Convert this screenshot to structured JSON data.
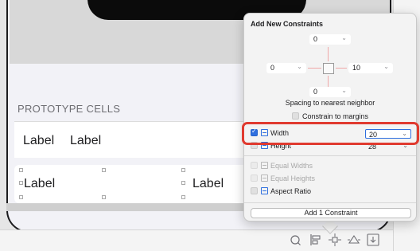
{
  "canvas": {
    "section_header": "PROTOTYPE CELLS",
    "cell1": {
      "label_a": "Label",
      "label_b": "Label"
    },
    "cell2": {
      "label_a": "Label",
      "label_b": "Label"
    }
  },
  "bottom_toolbar": {
    "icons": [
      "update-frames-icon",
      "align-icon",
      "add-constraints-icon",
      "resolve-issues-icon",
      "embed-in-icon"
    ]
  },
  "popover": {
    "title": "Add New Constraints",
    "spacing": {
      "top": "0",
      "leading": "0",
      "trailing": "10",
      "bottom": "0"
    },
    "spacing_caption": "Spacing to nearest neighbor",
    "constrain_to_margins": {
      "label": "Constrain to margins",
      "checked": false
    },
    "width": {
      "label": "Width",
      "value": "20",
      "checked": true
    },
    "height": {
      "label": "Height",
      "value": "28",
      "checked": false
    },
    "equal_widths": {
      "label": "Equal Widths",
      "enabled": false
    },
    "equal_heights": {
      "label": "Equal Heights",
      "enabled": false
    },
    "aspect_ratio": {
      "label": "Aspect Ratio",
      "checked": false
    },
    "add_button": "Add 1 Constraint"
  },
  "colors": {
    "highlight": "#e03a2f",
    "accent": "#2f6fdf",
    "spacing_beam": "#f0a8a8"
  }
}
